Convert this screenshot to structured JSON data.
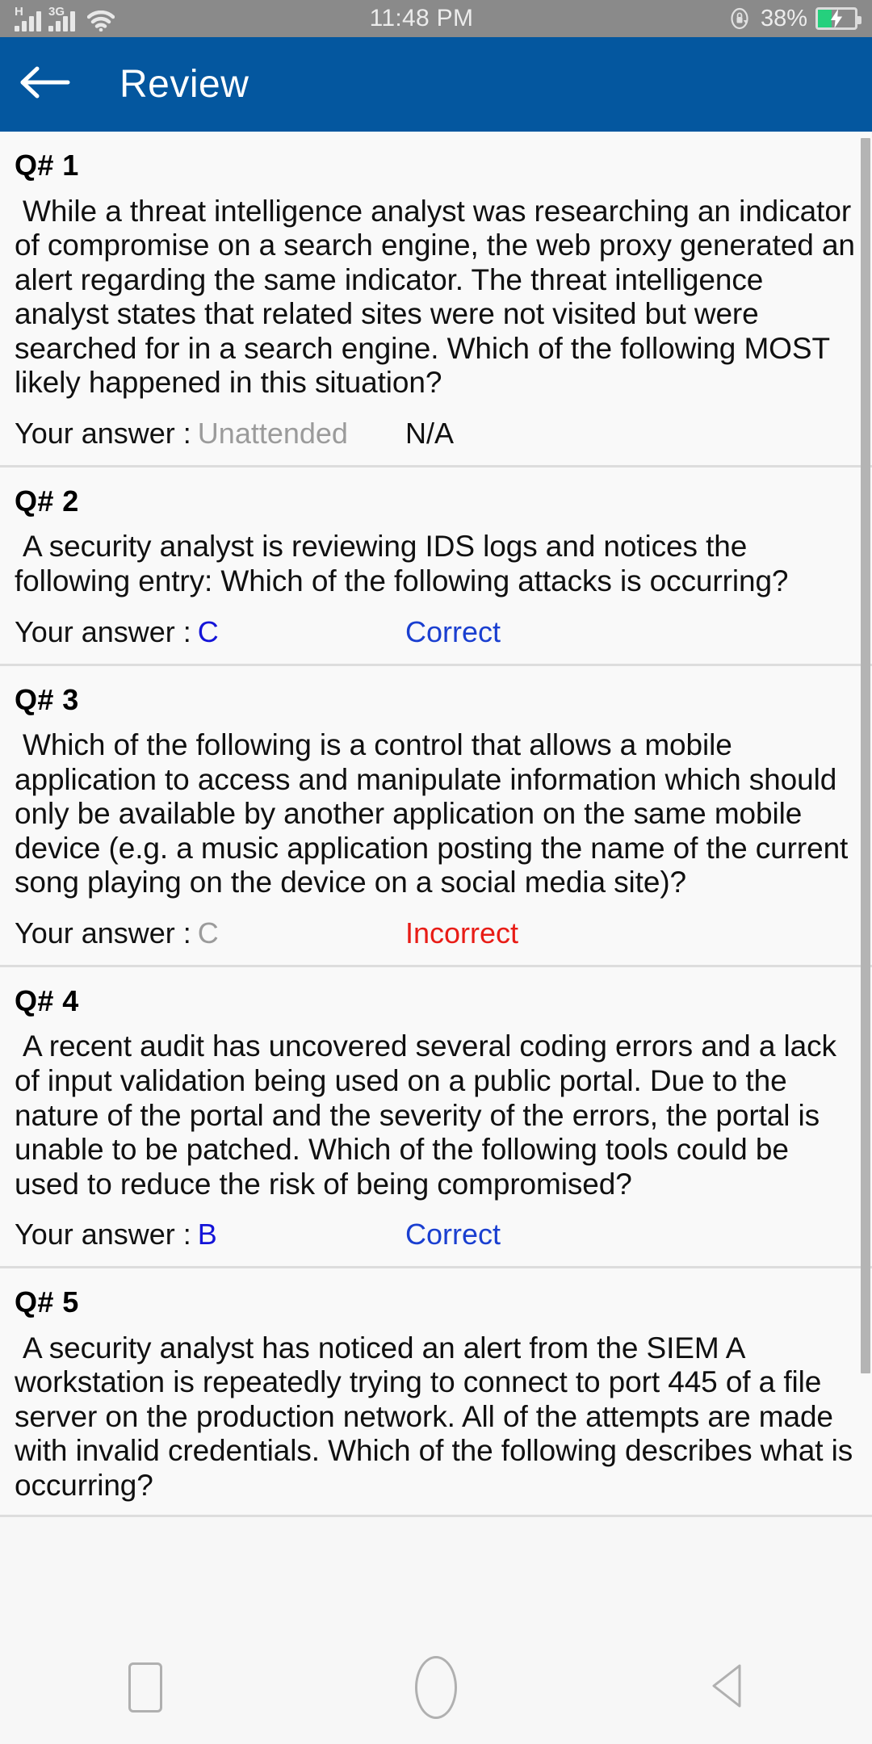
{
  "status_bar": {
    "sim1_network": "H",
    "sim2_network": "3G",
    "wifi_icon": "wifi-icon",
    "time": "11:48 PM",
    "rotation_lock_icon": "rotation-lock-icon",
    "battery_percent": "38%",
    "battery_icon": "battery-charging-icon",
    "background_color": "#8a8a8a"
  },
  "app_bar": {
    "back_icon": "back-arrow-icon",
    "title": "Review",
    "background_color": "#04579f"
  },
  "colors": {
    "correct": "#1a3fd0",
    "incorrect": "#e81c16",
    "unattended": "#9b9b9b",
    "answer_blue": "#1414d8"
  },
  "answer_label": "Your answer :",
  "questions": [
    {
      "number": "Q# 1",
      "text": "While a threat intelligence analyst was researching an indicator of compromise on a search engine, the web proxy generated an alert regarding the same indicator. The threat intelligence analyst states that related sites were not visited but were searched for in a search engine. Which of the following MOST likely happened in this situation?",
      "answer": "Unattended",
      "answer_style": "gray",
      "status": "N/A",
      "status_style": "black"
    },
    {
      "number": "Q# 2",
      "text": "A security analyst is reviewing IDS logs and notices the following entry:  Which of the following attacks is occurring?",
      "answer": "C",
      "answer_style": "blue",
      "status": "Correct",
      "status_style": "blue"
    },
    {
      "number": "Q# 3",
      "text": "Which of the following is a control that allows a mobile application to access and manipulate information which should only be available by another application on the same mobile device (e.g. a music application posting the name of the current song playing on the device on a social media site)?",
      "answer": "C",
      "answer_style": "gray",
      "status": "Incorrect",
      "status_style": "red"
    },
    {
      "number": "Q# 4",
      "text": "A recent audit has uncovered several coding errors and a lack of input validation being used on a public portal. Due to the nature of the portal and the severity of the errors, the portal is unable to be patched. Which of the following tools could be used to reduce the risk of being compromised?",
      "answer": "B",
      "answer_style": "blue",
      "status": "Correct",
      "status_style": "blue"
    },
    {
      "number": "Q# 5",
      "text": "A security analyst has noticed an alert from the SIEM A workstation is repeatedly trying to connect to port 445 of a file server on the production network. All of the attempts are made with invalid credentials. Which of the following describes what is occurring?",
      "answer": "",
      "answer_style": "",
      "status": "",
      "status_style": ""
    }
  ],
  "nav_bar": {
    "recents_icon": "recents-square-icon",
    "home_icon": "home-circle-icon",
    "back_icon": "back-triangle-icon"
  }
}
